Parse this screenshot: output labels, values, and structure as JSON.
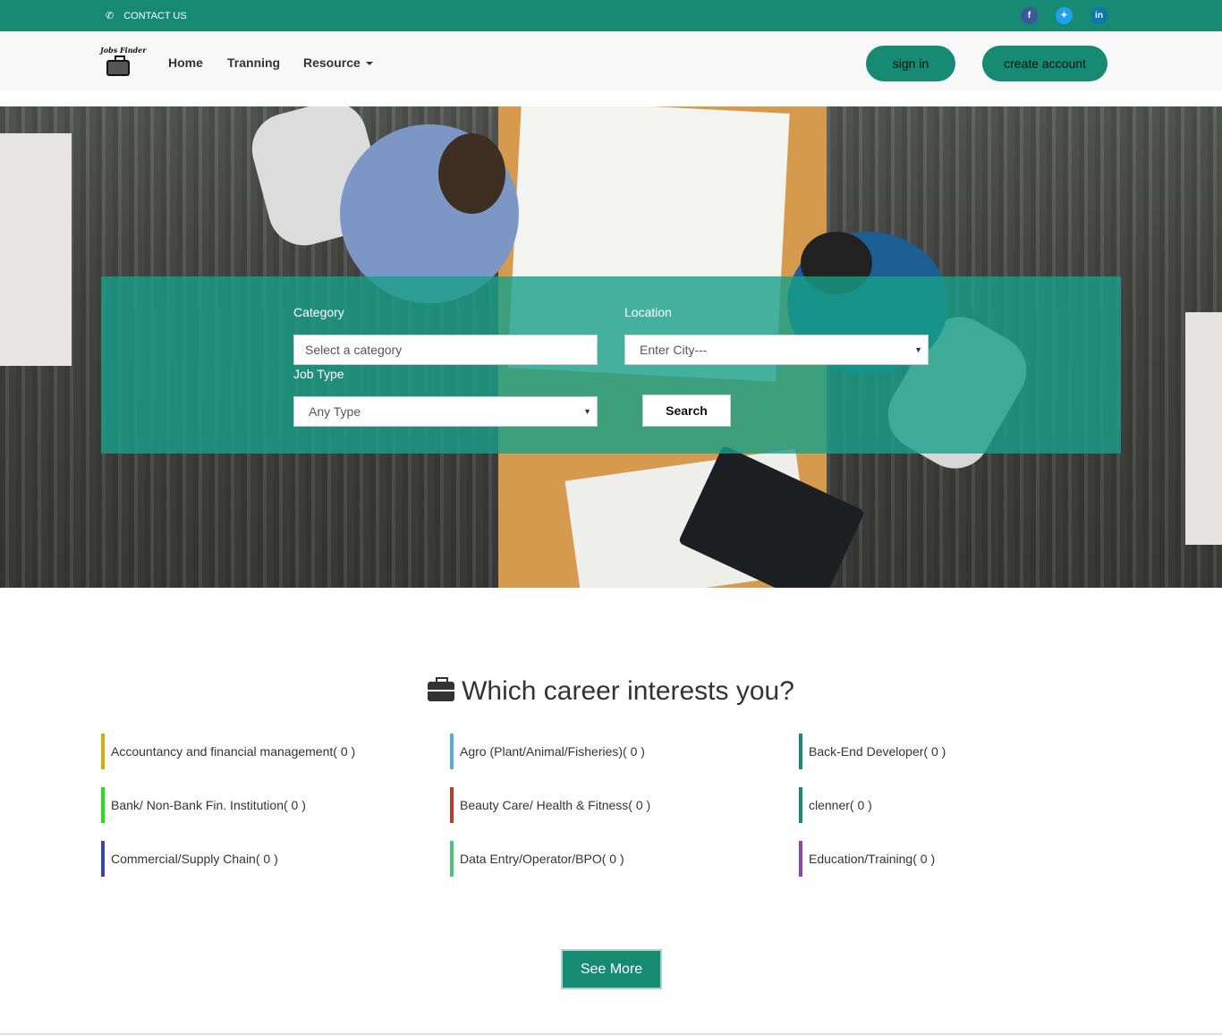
{
  "topbar": {
    "contact_label": "CONTACT US",
    "social": {
      "facebook": "f",
      "twitter": "t",
      "linkedin": "in"
    }
  },
  "nav": {
    "logo_text": "Jobs Finder",
    "home": "Home",
    "training": "Tranning",
    "resource": "Resource",
    "sign_in": "sign in",
    "create_account": "create account"
  },
  "search": {
    "category_label": "Category",
    "category_placeholder": "Select a category",
    "location_label": "Location",
    "location_value": "Enter City---",
    "job_type_label": "Job Type",
    "job_type_value": "Any Type",
    "search_button": "Search"
  },
  "career": {
    "title": "Which career interests you?",
    "categories": [
      {
        "label": "Accountancy and financial management( 0 )",
        "color": "#d4aa13"
      },
      {
        "label": "Agro (Plant/Animal/Fisheries)( 0 )",
        "color": "#5aa9e0"
      },
      {
        "label": "Back-End Developer( 0 )",
        "color": "#178a74"
      },
      {
        "label": "Bank/ Non-Bank Fin. Institution( 0 )",
        "color": "#22e01a"
      },
      {
        "label": "Beauty Care/ Health & Fitness( 0 )",
        "color": "#c0392b"
      },
      {
        "label": "clenner( 0 )",
        "color": "#178a74"
      },
      {
        "label": "Commercial/Supply Chain( 0 )",
        "color": "#3446b0"
      },
      {
        "label": "Data Entry/Operator/BPO( 0 )",
        "color": "#4ec27a"
      },
      {
        "label": "Education/Training( 0 )",
        "color": "#8e44ad"
      }
    ],
    "see_more": "See More"
  },
  "colors": {
    "brand": "#178a74"
  }
}
